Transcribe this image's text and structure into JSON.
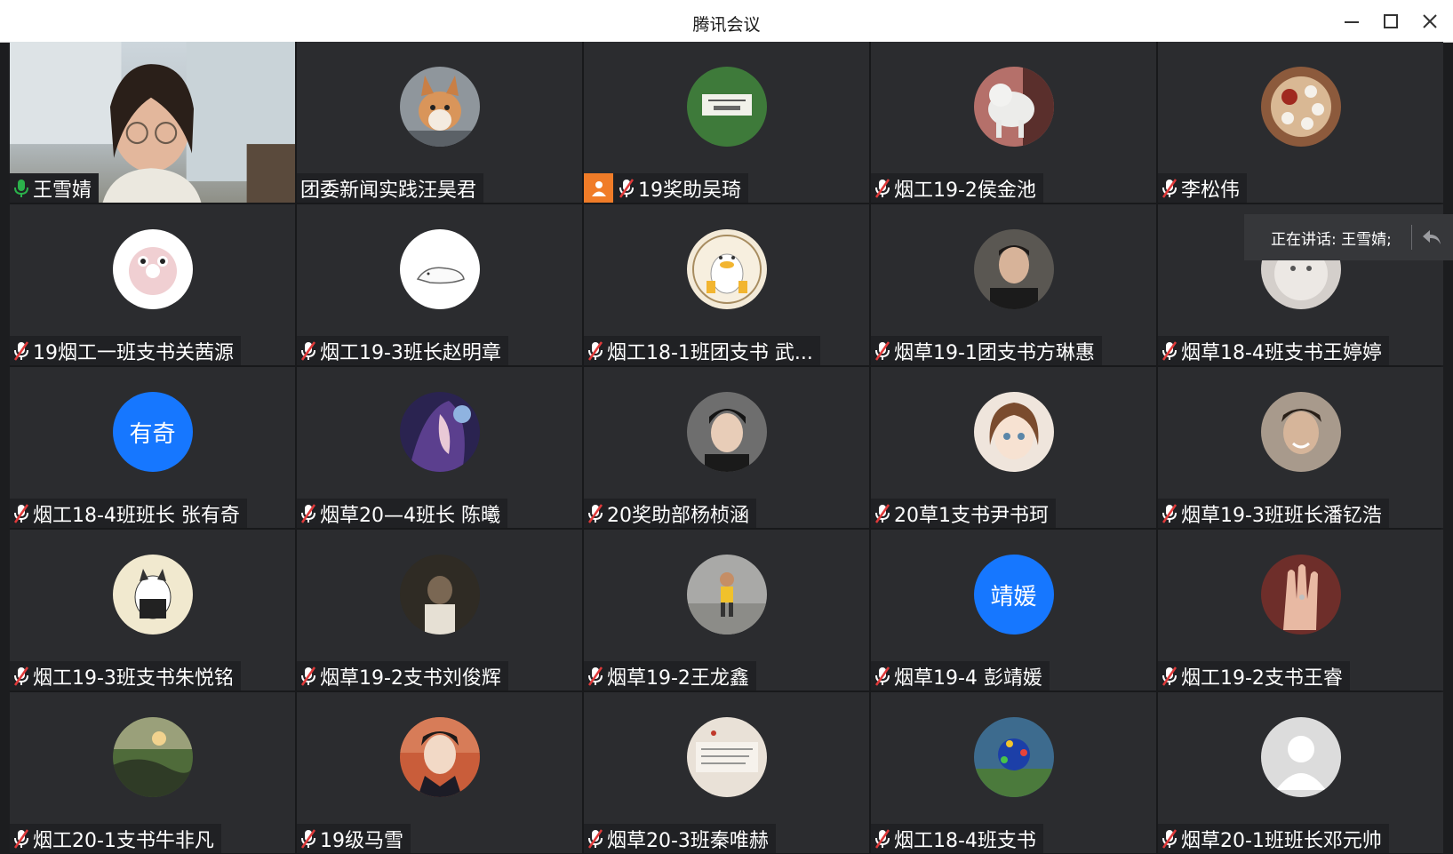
{
  "window": {
    "title": "腾讯会议"
  },
  "speaking": {
    "label": "正在讲话: 王雪婧;"
  },
  "participants": [
    {
      "name": "王雪婧",
      "avatar": "self-video",
      "mic": "on",
      "active": true
    },
    {
      "name": "团委新闻实践汪昊君",
      "avatar": "corgi-photo",
      "mic": "none"
    },
    {
      "name": "19奖助吴琦",
      "avatar": "green-sign-photo",
      "mic": "muted",
      "host": true
    },
    {
      "name": "烟工19-2侯金池",
      "avatar": "dog-photo",
      "mic": "muted"
    },
    {
      "name": "李松伟",
      "avatar": "tea-set-photo",
      "mic": "muted"
    },
    {
      "name": "19烟工一班支书关茜源",
      "avatar": "donut-photo",
      "mic": "muted"
    },
    {
      "name": "烟工19-3班长赵明章",
      "avatar": "seal-drawing",
      "mic": "muted"
    },
    {
      "name": "烟工18-1班团支书 武...",
      "avatar": "duck-cartoon",
      "mic": "muted"
    },
    {
      "name": "烟草19-1团支书方琳惠",
      "avatar": "man-portrait",
      "mic": "muted"
    },
    {
      "name": "烟草18-4班支书王婷婷",
      "avatar": "plush-toy-photo",
      "mic": "muted"
    },
    {
      "name": "烟工18-4班班长 张有奇",
      "avatar": "text",
      "avatar_text": "有奇",
      "mic": "muted"
    },
    {
      "name": "烟草20—4班长 陈曦",
      "avatar": "anime-art",
      "mic": "muted"
    },
    {
      "name": "20奖助部杨桢涵",
      "avatar": "boy-selfie",
      "mic": "muted"
    },
    {
      "name": "20草1支书尹书珂",
      "avatar": "anime-girl",
      "mic": "muted"
    },
    {
      "name": "烟草19-3班班长潘钇浩",
      "avatar": "smiling-man",
      "mic": "muted"
    },
    {
      "name": "烟工19-3班支书朱悦铭",
      "avatar": "cat-cartoon",
      "mic": "muted"
    },
    {
      "name": "烟草19-2支书刘俊辉",
      "avatar": "dark-person-photo",
      "mic": "muted"
    },
    {
      "name": "烟草19-2王龙鑫",
      "avatar": "child-walking-photo",
      "mic": "muted"
    },
    {
      "name": "烟草19-4 彭靖媛",
      "avatar": "text",
      "avatar_text": "靖媛",
      "mic": "muted"
    },
    {
      "name": "烟工19-2支书王睿",
      "avatar": "hand-photo",
      "mic": "muted"
    },
    {
      "name": "烟工20-1支书牛非凡",
      "avatar": "sunset-landscape",
      "mic": "muted"
    },
    {
      "name": "19级马雪",
      "avatar": "young-man-portrait",
      "mic": "muted"
    },
    {
      "name": "烟草20-3班秦唯赫",
      "avatar": "handwriting-card",
      "mic": "muted"
    },
    {
      "name": "烟工18-4班支书",
      "avatar": "colorful-photo",
      "mic": "muted"
    },
    {
      "name": "烟草20-1班班长邓元帅",
      "avatar": "default-user",
      "mic": "muted"
    }
  ],
  "colors": {
    "tile_bg": "#2b2c2f",
    "active_border": "#2bb14b",
    "text_avatar_bg": "#1677ff",
    "host_badge": "#f07c28",
    "mic_on": "#2bb14b",
    "mic_muted": "#e03a3a"
  }
}
